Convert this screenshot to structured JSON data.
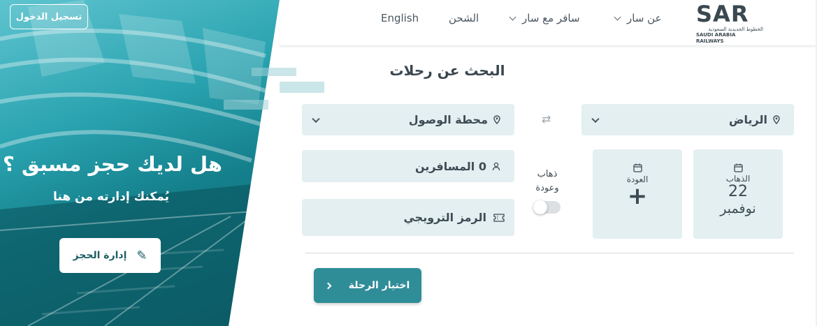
{
  "hero": {
    "login_label": "تسجيل الدخول",
    "title": "هل لديك حجز مسبق ؟",
    "subtitle": "يُمكنك إدارته من هنا",
    "manage_label": "إدارة الحجز"
  },
  "header": {
    "logo_main": "SAR",
    "logo_ar": "الخطوط الحديدية السعودية",
    "logo_en": "SAUDI ARABIA RAILWAYS",
    "nav": {
      "about": "عن سار",
      "travel": "سافر مع سار",
      "cargo": "الشحن",
      "language": "English"
    }
  },
  "search": {
    "title": "البحث عن رحلات",
    "from_value": "الرياض",
    "to_value": "محطة الوصول",
    "passengers_label": "0 المسافرين",
    "promo_label": "الرمز الترويجي",
    "departure": {
      "label": "الذهاب",
      "day": "22",
      "month": "نوفمبر"
    },
    "return": {
      "label": "العودة",
      "add": "+"
    },
    "round_trip_line1": "ذهاب",
    "round_trip_line2": "وعودة",
    "round_trip_enabled": false,
    "submit_label": "اختيار الرحلة"
  },
  "colors": {
    "brand_teal": "#2f8d98",
    "field_bg": "#e3eff1",
    "hero_teal": "#2aa3b0"
  }
}
